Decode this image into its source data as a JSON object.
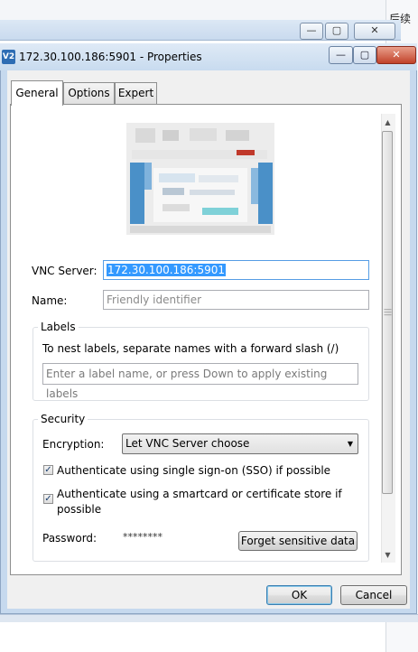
{
  "background": {
    "right_text": "后续框"
  },
  "parent_window": {
    "buttons": [
      "minimize",
      "restore",
      "close"
    ]
  },
  "window": {
    "icon_text": "V2",
    "title": "172.30.100.186:5901 - Properties",
    "buttons": [
      "minimize",
      "restore",
      "close"
    ]
  },
  "tabs": [
    {
      "label": "General",
      "active": true
    },
    {
      "label": "Options",
      "active": false
    },
    {
      "label": "Expert",
      "active": false
    }
  ],
  "form": {
    "vnc_server": {
      "label": "VNC Server:",
      "value": "172.30.100.186:5901"
    },
    "name": {
      "label": "Name:",
      "placeholder": "Friendly identifier"
    }
  },
  "labels_group": {
    "title": "Labels",
    "hint": "To nest labels, separate names with a forward slash (/)",
    "input_placeholder": "Enter a label name, or press Down to apply existing labels"
  },
  "security": {
    "title": "Security",
    "encryption_label": "Encryption:",
    "encryption_value": "Let VNC Server choose",
    "sso_label": "Authenticate using single sign-on (SSO) if possible",
    "sso_checked": true,
    "smartcard_label": "Authenticate using a smartcard or certificate store if possible",
    "smartcard_checked": true,
    "password_label": "Password:",
    "password_value": "********",
    "forget_button": "Forget sensitive data"
  },
  "buttons": {
    "ok": "OK",
    "cancel": "Cancel"
  },
  "icons": {
    "checkbox_mark": "✓",
    "dropdown_arrow": "▼",
    "scroll_up": "▲",
    "scroll_down": "▼"
  }
}
